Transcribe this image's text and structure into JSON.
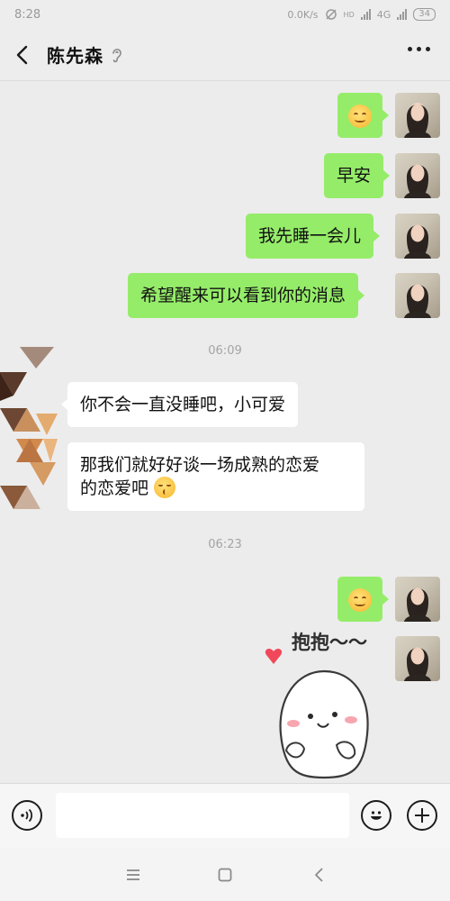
{
  "status_bar": {
    "time": "8:28",
    "net_speed": "0.0K/s",
    "hd_label": "HD",
    "network_label": "4G",
    "battery": "34"
  },
  "header": {
    "contact_name": "陈先森",
    "back_icon": "chevron-left-icon",
    "mode_icon": "ear-icon",
    "more_icon": "more-dots-icon"
  },
  "messages": [
    {
      "from": "me",
      "type": "emoji",
      "emoji": "smile"
    },
    {
      "from": "me",
      "type": "text",
      "text": "早安"
    },
    {
      "from": "me",
      "type": "text",
      "text": "我先睡一会儿"
    },
    {
      "from": "me",
      "type": "text",
      "text": "希望醒来可以看到你的消息"
    },
    {
      "type": "time",
      "text": "06:09"
    },
    {
      "from": "other",
      "type": "text",
      "text": "你不会一直没睡吧，小可爱"
    },
    {
      "from": "other",
      "type": "text",
      "text": "那我们就好好谈一场成熟的恋爱",
      "text2": "的恋爱吧",
      "emoji": "kiss"
    },
    {
      "type": "time",
      "text": "06:23"
    },
    {
      "from": "me",
      "type": "emoji",
      "emoji": "smile"
    },
    {
      "from": "me",
      "type": "sticker",
      "text": "抱抱～～"
    }
  ],
  "input_bar": {
    "voice_icon": "voice-icon",
    "input_value": "",
    "emoji_icon": "emoji-icon",
    "add_icon": "plus-icon"
  },
  "nav_bar": {
    "menu_icon": "menu-icon",
    "home_icon": "home-square-icon",
    "back_icon": "back-triangle-icon"
  },
  "colors": {
    "my_bubble": "#95ec69",
    "other_bubble": "#ffffff",
    "background": "#ececec"
  }
}
